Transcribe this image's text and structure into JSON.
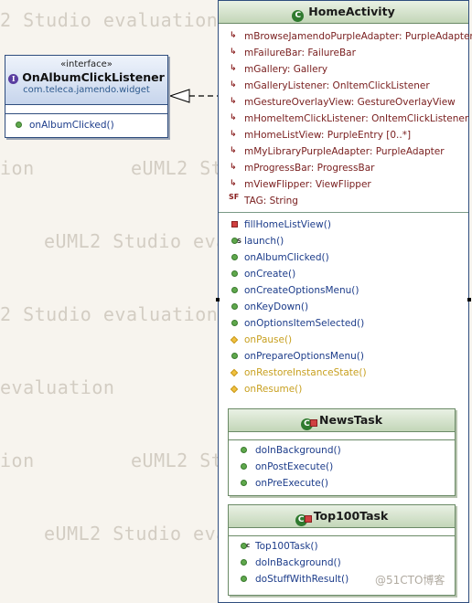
{
  "watermarks": [
    "2 Studio evaluation",
    "ion",
    "eUML2 St",
    "eUML2 Studio eva",
    "2 Studio evaluation",
    "evaluation",
    "ion",
    "eUML2 St",
    "eUML2 Studio eva"
  ],
  "interface": {
    "stereotype": "«interface»",
    "name": "OnAlbumClickListener",
    "package": "com.teleca.jamendo.widget",
    "methods": [
      "onAlbumClicked()"
    ]
  },
  "home_activity": {
    "name": "HomeActivity",
    "fields": [
      {
        "text": "mBrowseJamendoPurpleAdapter: PurpleAdapter",
        "icon": "private-field-icon"
      },
      {
        "text": "mFailureBar: FailureBar",
        "icon": "private-field-icon"
      },
      {
        "text": "mGallery: Gallery",
        "icon": "private-field-icon"
      },
      {
        "text": "mGalleryListener: OnItemClickListener",
        "icon": "private-field-icon"
      },
      {
        "text": "mGestureOverlayView: GestureOverlayView",
        "icon": "private-field-icon"
      },
      {
        "text": "mHomeItemClickListener: OnItemClickListener",
        "icon": "private-field-icon"
      },
      {
        "text": "mHomeListView: PurpleEntry [0..*]",
        "icon": "private-field-icon"
      },
      {
        "text": "mMyLibraryPurpleAdapter: PurpleAdapter",
        "icon": "private-field-icon"
      },
      {
        "text": "mProgressBar: ProgressBar",
        "icon": "private-field-icon"
      },
      {
        "text": "mViewFlipper: ViewFlipper",
        "icon": "private-field-icon"
      },
      {
        "text": "TAG: String",
        "icon": "static-final-field-icon"
      }
    ],
    "methods": [
      {
        "text": "fillHomeListView()",
        "icon": "private-method-icon"
      },
      {
        "text": "launch()",
        "icon": "static-method-icon"
      },
      {
        "text": "onAlbumClicked()",
        "icon": "public-method-icon"
      },
      {
        "text": "onCreate()",
        "icon": "public-method-icon"
      },
      {
        "text": "onCreateOptionsMenu()",
        "icon": "public-method-icon"
      },
      {
        "text": "onKeyDown()",
        "icon": "public-method-icon"
      },
      {
        "text": "onOptionsItemSelected()",
        "icon": "public-method-icon"
      },
      {
        "text": "onPause()",
        "icon": "protected-method-icon"
      },
      {
        "text": "onPrepareOptionsMenu()",
        "icon": "public-method-icon"
      },
      {
        "text": "onRestoreInstanceState()",
        "icon": "protected-method-icon"
      },
      {
        "text": "onResume()",
        "icon": "protected-method-icon"
      }
    ]
  },
  "news_task": {
    "name": "NewsTask",
    "methods": [
      "doInBackground()",
      "onPostExecute()",
      "onPreExecute()"
    ]
  },
  "top100_task": {
    "name": "Top100Task",
    "methods": [
      "Top100Task()",
      "doInBackground()",
      "doStuffWithResult()"
    ]
  },
  "footer_watermark": "@51CTO博客",
  "colors": {
    "class_border": "#2f4d7e",
    "header_green": "#c3d6b8",
    "field_text": "#7a2020"
  }
}
